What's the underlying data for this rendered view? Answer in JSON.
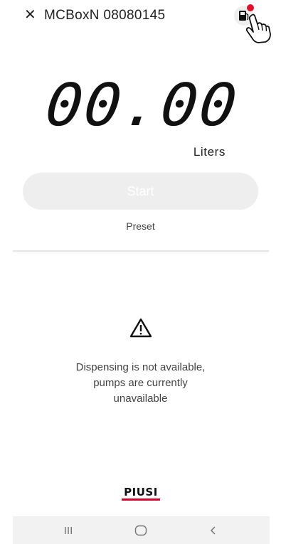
{
  "header": {
    "close_glyph": "✕",
    "title": "MCBoxN 08080145",
    "pump_icon": "fuel-pump-icon",
    "status_dot_color": "#e0102a"
  },
  "display": {
    "value": "00.00",
    "unit": "Liters"
  },
  "actions": {
    "start_label": "Start",
    "preset_label": "Preset"
  },
  "status": {
    "icon": "warning-icon",
    "message_line1": "Dispensing is not available,",
    "message_line2": "pumps are currently",
    "message_line3": "unavailable"
  },
  "brand": {
    "logo_text": "PIUSI",
    "accent_color": "#d4002b"
  },
  "navbar": {
    "recent_icon": "recent-apps-icon",
    "home_icon": "home-icon",
    "back_icon": "back-icon"
  }
}
